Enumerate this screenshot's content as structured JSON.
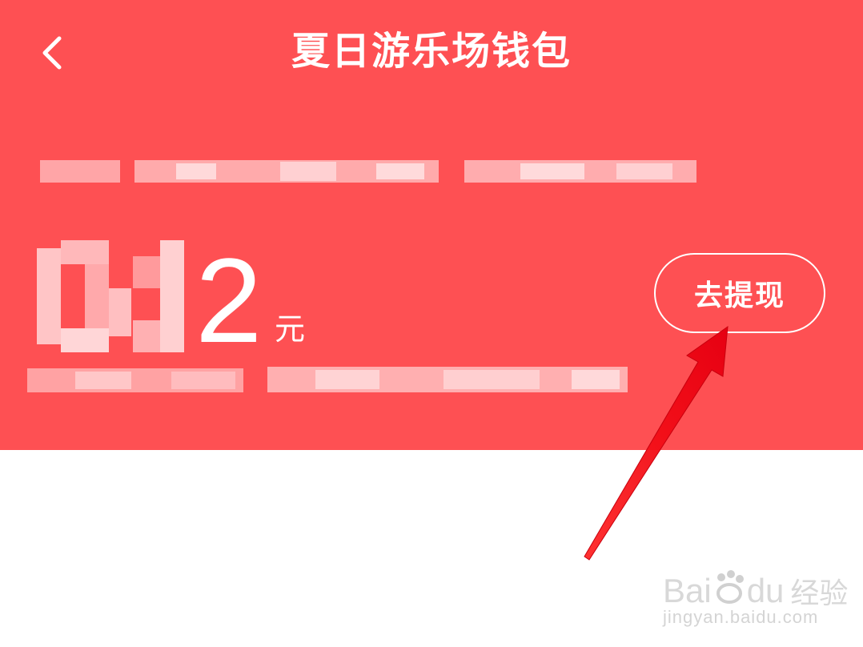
{
  "header": {
    "title": "夏日游乐场钱包",
    "background_color": "#fe5053",
    "back_icon": "chevron-left-icon"
  },
  "balance": {
    "amount_visible_digit": "2",
    "unit": "元"
  },
  "withdraw_button": {
    "label": "去提现"
  },
  "annotation": {
    "arrow_color": "#ff1a1a"
  },
  "watermark": {
    "logo_text_left": "Bai",
    "logo_text_right": "du",
    "logo_cn": "经验",
    "url": "jingyan.baidu.com"
  }
}
